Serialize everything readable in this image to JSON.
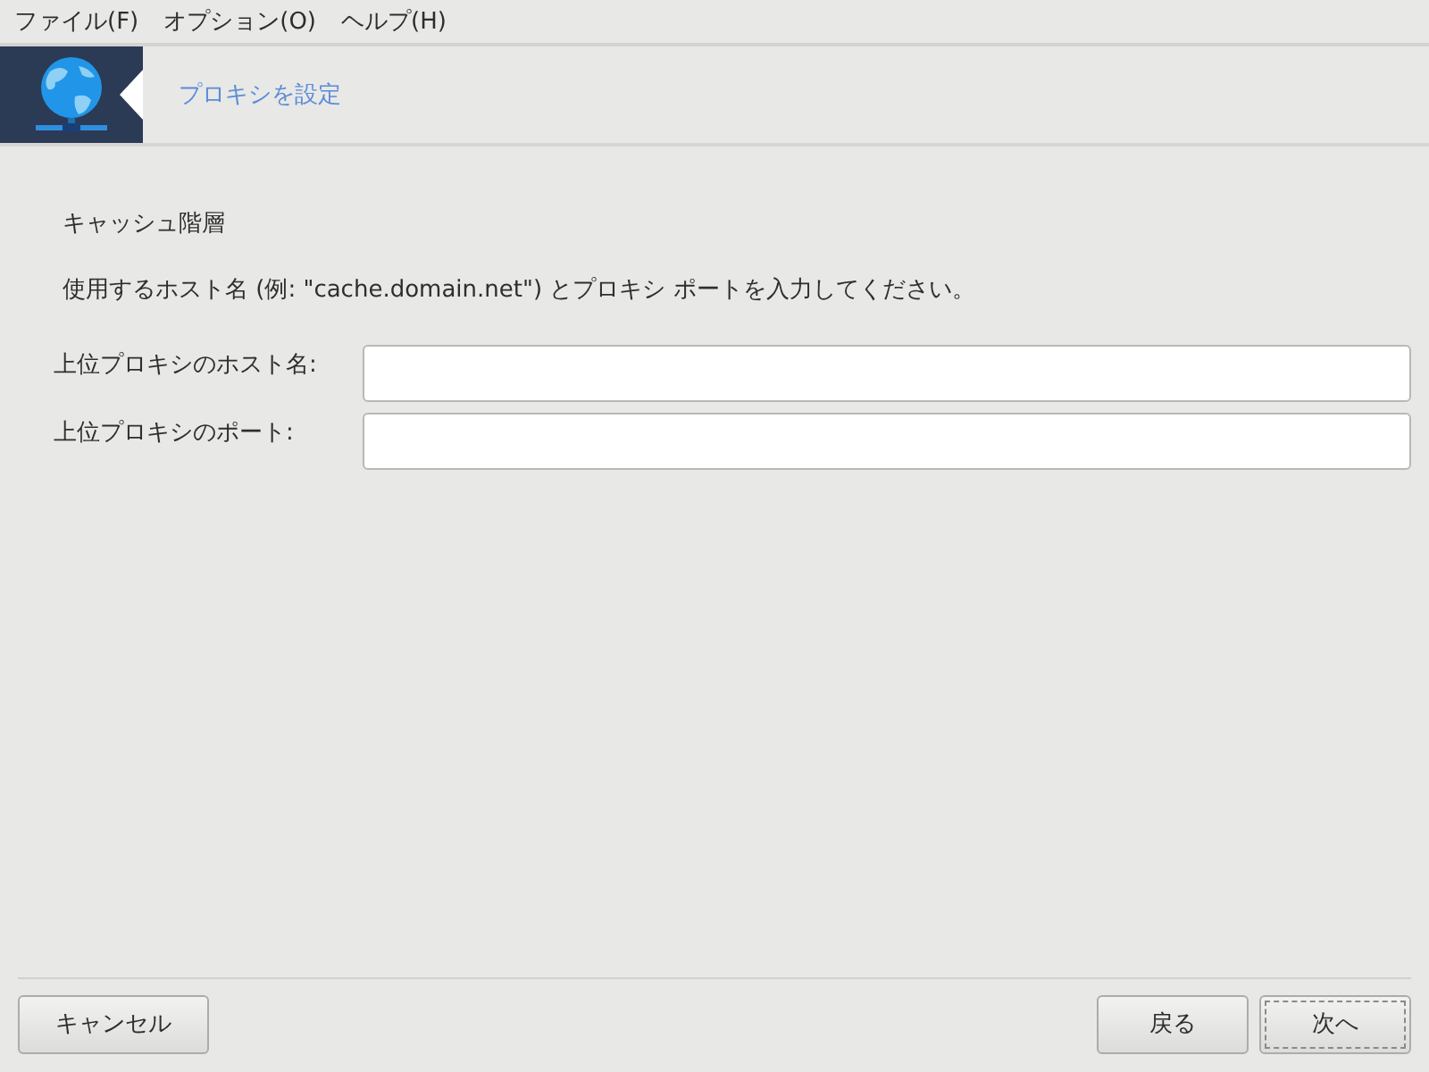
{
  "menu": [
    "ファイル(F)",
    "オプション(O)",
    "ヘルプ(H)"
  ],
  "header": {
    "title": "プロキシを設定"
  },
  "section_title": "キャッシュ階層",
  "description": "使用するホスト名 (例: \"cache.domain.net\") とプロキシ ポートを入力してください。",
  "fields": [
    {
      "label": "上位プロキシのホスト名:"
    },
    {
      "label": "上位プロキシのポート:"
    }
  ],
  "buttons": [
    {
      "label": "キャンセル",
      "focused": false
    },
    {
      "label": "戻る",
      "focused": false
    },
    {
      "label": "次へ",
      "focused": true
    }
  ]
}
